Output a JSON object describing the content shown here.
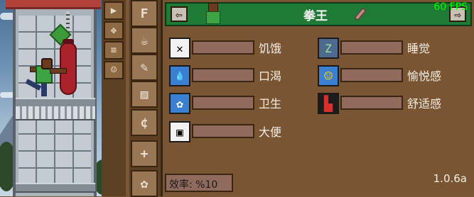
{
  "hud": {
    "fps": "60 FPS",
    "version": "1.0.6a"
  },
  "toolbar": {
    "tools": [
      {
        "icon": "play-icon",
        "glyph": "▶"
      },
      {
        "icon": "move-icon",
        "glyph": "✥"
      },
      {
        "icon": "bone-icon",
        "glyph": "≡"
      },
      {
        "icon": "figure-icon",
        "glyph": "☺"
      }
    ]
  },
  "tabs": [
    {
      "icon": "favorites-icon",
      "glyph": "F"
    },
    {
      "icon": "mug-icon",
      "glyph": "☕"
    },
    {
      "icon": "notes-icon",
      "glyph": "✎"
    },
    {
      "icon": "stripes-icon",
      "glyph": "▨"
    },
    {
      "icon": "coin-icon",
      "glyph": "¢"
    },
    {
      "icon": "add-person-icon",
      "glyph": "+"
    },
    {
      "icon": "paw-icon",
      "glyph": "✿"
    }
  ],
  "character": {
    "name": "拳王",
    "prev_label": "⇦",
    "next_label": "⇨"
  },
  "needs_left": [
    {
      "label": "饥饿",
      "icon": "fork-knife-icon",
      "glyph": "✕",
      "level": 0
    },
    {
      "label": "口渴",
      "icon": "water-drop-icon",
      "glyph": "💧",
      "level": 0
    },
    {
      "label": "卫生",
      "icon": "soap-icon",
      "glyph": "✿",
      "level": 0
    },
    {
      "label": "大便",
      "icon": "toilet-paper-icon",
      "glyph": "▣",
      "level": 0
    }
  ],
  "needs_right": [
    {
      "label": "睡觉",
      "icon": "sleep-icon",
      "glyph": "Z",
      "level": 0
    },
    {
      "label": "愉悦感",
      "icon": "smiley-icon",
      "glyph": "☺",
      "level": 0
    },
    {
      "label": "舒适感",
      "icon": "armchair-icon",
      "glyph": "▙",
      "level": 0
    }
  ],
  "efficiency": {
    "label": "效率: %10"
  },
  "colors": {
    "header_green": "#1f7a35",
    "panel_brown": "#7a5533",
    "bar_empty": "#8f6a5d",
    "fps_green": "#00ff00"
  }
}
